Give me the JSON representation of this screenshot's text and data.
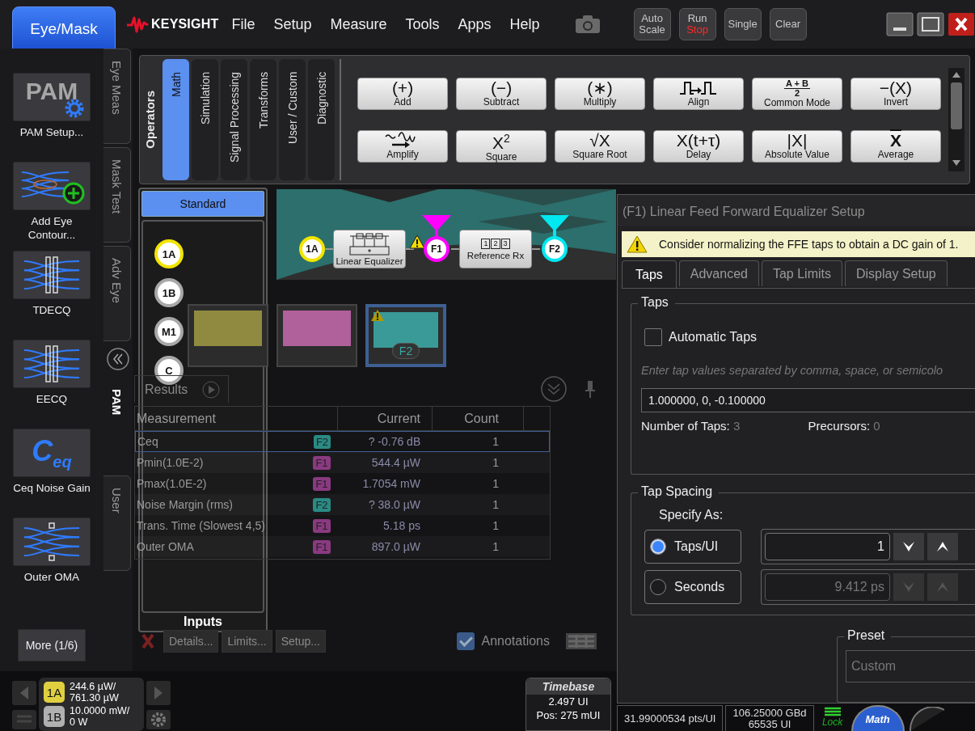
{
  "top_bar": {
    "mode_button": "Eye/Mask",
    "brand": "KEYSIGHT",
    "menu": [
      "File",
      "Setup",
      "Measure",
      "Tools",
      "Apps",
      "Help"
    ],
    "buttons": [
      {
        "kind": "plain",
        "label": "Auto Scale"
      },
      {
        "kind": "run",
        "label": "Run",
        "state": "Stop"
      },
      {
        "kind": "plain",
        "label": "Single"
      },
      {
        "kind": "plain",
        "label": "Clear"
      }
    ]
  },
  "app_sidebar": {
    "items": [
      {
        "kind": "pam",
        "icon_text": "PAM",
        "label": "PAM Setup..."
      },
      {
        "kind": "contour",
        "label": "Add Eye Contour..."
      },
      {
        "kind": "bars",
        "label": "TDECQ"
      },
      {
        "kind": "bars",
        "label": "EECQ"
      },
      {
        "kind": "ceq",
        "icon_text": "C$_{eq}$",
        "label": "Ceq Noise Gain"
      },
      {
        "kind": "oma",
        "label": "Outer OMA"
      }
    ],
    "more_button": "More (1/6)"
  },
  "side_tabs": [
    {
      "kind": "tab",
      "label": "Eye Meas",
      "selected": false
    },
    {
      "kind": "tab",
      "label": "Mask Test",
      "selected": false
    },
    {
      "kind": "tab",
      "label": "Adv Eye",
      "selected": false
    },
    {
      "kind": "collapse"
    },
    {
      "kind": "tab",
      "label": "PAM",
      "selected": true
    },
    {
      "kind": "tab",
      "label": "User",
      "selected": false
    }
  ],
  "operators": {
    "title": "Operators",
    "tabs": [
      {
        "label": "Math",
        "selected": true
      },
      {
        "label": "Simulation",
        "selected": false
      },
      {
        "label": "Signal Processing",
        "selected": false
      },
      {
        "label": "Transforms",
        "selected": false
      },
      {
        "label": "User / Custom",
        "selected": false
      },
      {
        "label": "Diagnostic",
        "selected": false
      }
    ],
    "items": [
      {
        "kind": "text",
        "symbol": "(+)",
        "label": "Add"
      },
      {
        "kind": "text",
        "symbol": "(−)",
        "label": "Subtract"
      },
      {
        "kind": "text",
        "symbol": "(∗)",
        "label": "Multiply"
      },
      {
        "kind": "align",
        "label": "Align"
      },
      {
        "kind": "fraction",
        "symbol": "A + B",
        "denominator": "2",
        "label": "Common Mode"
      },
      {
        "kind": "text",
        "symbol": "−(X)",
        "label": "Invert"
      },
      {
        "kind": "amplify",
        "label": "Amplify"
      },
      {
        "kind": "text",
        "symbol": "X$^{2}$",
        "label": "Square"
      },
      {
        "kind": "text",
        "symbol": "√X",
        "label": "Square Root"
      },
      {
        "kind": "text",
        "symbol": "X(t+τ)",
        "label": "Delay"
      },
      {
        "kind": "text",
        "symbol": "|X|",
        "label": "Absolute Value"
      },
      {
        "kind": "overline",
        "symbol": "X",
        "label": "Average"
      }
    ]
  },
  "workspace": {
    "inputs": {
      "header": "Standard",
      "sources": [
        {
          "label": "1A",
          "color": "#f2e400"
        },
        {
          "label": "1B",
          "color": "#a8a8a8"
        },
        {
          "label": "M1",
          "color": "#a8a8a8"
        },
        {
          "label": "C",
          "color": "#a8a8a8"
        }
      ],
      "footer": "Inputs"
    },
    "diagram": [
      {
        "kind": "source",
        "label": "1A",
        "color": "#f2e400"
      },
      {
        "kind": "equalizer",
        "label": "Linear Equalizer"
      },
      {
        "kind": "warning"
      },
      {
        "kind": "function",
        "label": "F1",
        "color": "#ff00ff"
      },
      {
        "kind": "receiver",
        "digits": [
          "1",
          "2",
          "3"
        ],
        "label": "Reference Rx"
      },
      {
        "kind": "function",
        "label": "F2",
        "color": "#00e8f0"
      }
    ],
    "thumbnails": [
      {
        "color": "#8f8a40",
        "selected": false,
        "warning": false
      },
      {
        "color": "#b0609a",
        "selected": false,
        "warning": false
      },
      {
        "color": "#3a9a98",
        "selected": true,
        "warning": true,
        "label": "F2"
      }
    ],
    "results": {
      "tab": "Results",
      "columns": [
        "Measurement",
        "Current",
        "Count"
      ],
      "rows": [
        {
          "name": "Ceq",
          "source": "F2",
          "color": "#2a8a84",
          "current": "? -0.76 dB",
          "count": "1",
          "selected": true
        },
        {
          "name": "Pmin(1.0E-2)",
          "source": "F1",
          "color": "#8a3a80",
          "current": "544.4 µW",
          "count": "1",
          "selected": false
        },
        {
          "name": "Pmax(1.0E-2)",
          "source": "F1",
          "color": "#8a3a80",
          "current": "1.7054 mW",
          "count": "1",
          "selected": false
        },
        {
          "name": "Noise Margin (rms)",
          "source": "F2",
          "color": "#2a8a84",
          "current": "? 38.0 µW",
          "count": "1",
          "selected": false
        },
        {
          "name": "Trans. Time (Slowest 4,5)",
          "source": "F1",
          "color": "#8a3a80",
          "current": "5.18 ps",
          "count": "1",
          "selected": false
        },
        {
          "name": "Outer OMA",
          "source": "F1",
          "color": "#8a3a80",
          "current": "897.0 µW",
          "count": "1",
          "selected": false
        }
      ],
      "actions": [
        "Details...",
        "Limits...",
        "Setup..."
      ],
      "annotations": {
        "label": "Annotations",
        "checked": true
      }
    }
  },
  "dialog": {
    "title": "(F1) Linear Feed Forward Equalizer Setup",
    "warning": "Consider normalizing the FFE taps to obtain a DC gain of 1.",
    "tabs": [
      {
        "label": "Taps",
        "selected": true
      },
      {
        "label": "Advanced",
        "selected": false
      },
      {
        "label": "Tap Limits",
        "selected": false
      },
      {
        "label": "Display Setup",
        "selected": false
      }
    ],
    "taps_group": {
      "title": "Taps",
      "automatic": {
        "label": "Automatic Taps",
        "checked": false
      },
      "hint": "Enter tap values separated by comma, space, or semicolo",
      "value": "1.000000, 0, -0.100000",
      "number_label": "Number of Taps:",
      "number_value": "3",
      "precursors_label": "Precursors:",
      "precursors_value": "0"
    },
    "spacing_group": {
      "title": "Tap Spacing",
      "specify_label": "Specify As:",
      "options": [
        {
          "label": "Taps/UI",
          "selected": true,
          "value": "1",
          "disabled": false
        },
        {
          "label": "Seconds",
          "selected": false,
          "value": "9.412 ps",
          "disabled": true
        }
      ]
    },
    "preset_group": {
      "title": "Preset",
      "value": "Custom"
    }
  },
  "bottom_bar": {
    "channels": [
      {
        "label": "1A",
        "color": "#e0d040",
        "line1": "244.6 µW/",
        "line2": "761.30 µW"
      },
      {
        "label": "1B",
        "color": "#b0b0b0",
        "line1": "10.0000 mW/",
        "line2": "0 W"
      }
    ],
    "timebase": {
      "title": "Timebase",
      "scale": "2.497 UI",
      "position": "Pos: 275 mUI"
    },
    "stats": [
      [
        "31.99000534 pts/UI"
      ],
      [
        "106.25000 GBd",
        "65535 UI"
      ]
    ],
    "lock": "Lock",
    "math_button": "Math"
  }
}
